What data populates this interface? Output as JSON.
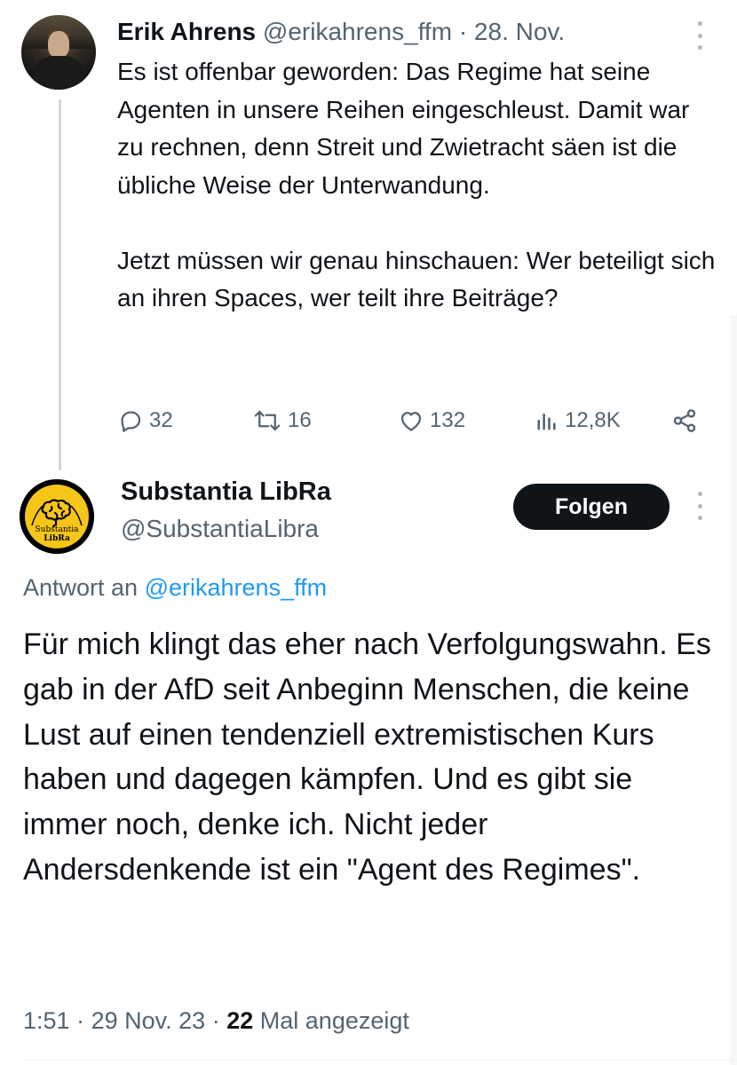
{
  "tweet1": {
    "author_name": "Erik Ahrens",
    "handle": "@erikahrens_ffm",
    "separator": "·",
    "date": "28. Nov.",
    "paragraphs": [
      "Es ist offenbar geworden: Das Regime hat seine Agenten in unsere Reihen eingeschleust. Damit war zu rechnen, denn Streit und Zwietracht säen ist die übliche Weise der Unterwandung.",
      "Jetzt müssen wir genau hinschauen: Wer beteiligt sich an ihren Spaces, wer teilt ihre Beiträge?"
    ],
    "actions": {
      "replies": "32",
      "reposts": "16",
      "likes": "132",
      "views": "12,8K"
    }
  },
  "tweet2": {
    "author_name": "Substantia LibRa",
    "handle": "@SubstantiaLibra",
    "follow_label": "Folgen",
    "avatar_text": {
      "line1": "Substantia",
      "line2": "LibRa"
    },
    "reply_prefix": "Antwort an",
    "reply_mention": "@erikahrens_ffm",
    "text": "Für mich klingt das eher nach Verfolgungswahn. Es gab in der AfD seit Anbeginn Menschen, die keine Lust auf einen tendenziell extremistischen Kurs haben und dagegen kämpfen. Und es gibt sie immer noch, denke ich. Nicht jeder Andersdenkende ist ein \"Agent des Regimes\".",
    "time": "1:51",
    "separator": "·",
    "date": "29 Nov. 23",
    "views_count": "22",
    "views_label": "Mal angezeigt"
  },
  "icons": {
    "reply": "comment-bubble-icon",
    "repost": "repost-arrows-icon",
    "like": "heart-icon",
    "views": "bar-chart-icon",
    "share": "share-icon",
    "more": "more-vertical-dots-icon"
  },
  "colors": {
    "text": "#0f1419",
    "secondary": "#536471",
    "link": "#1d9bf0",
    "thread_line": "#cfd9de",
    "logo_yellow": "#f5c518"
  }
}
